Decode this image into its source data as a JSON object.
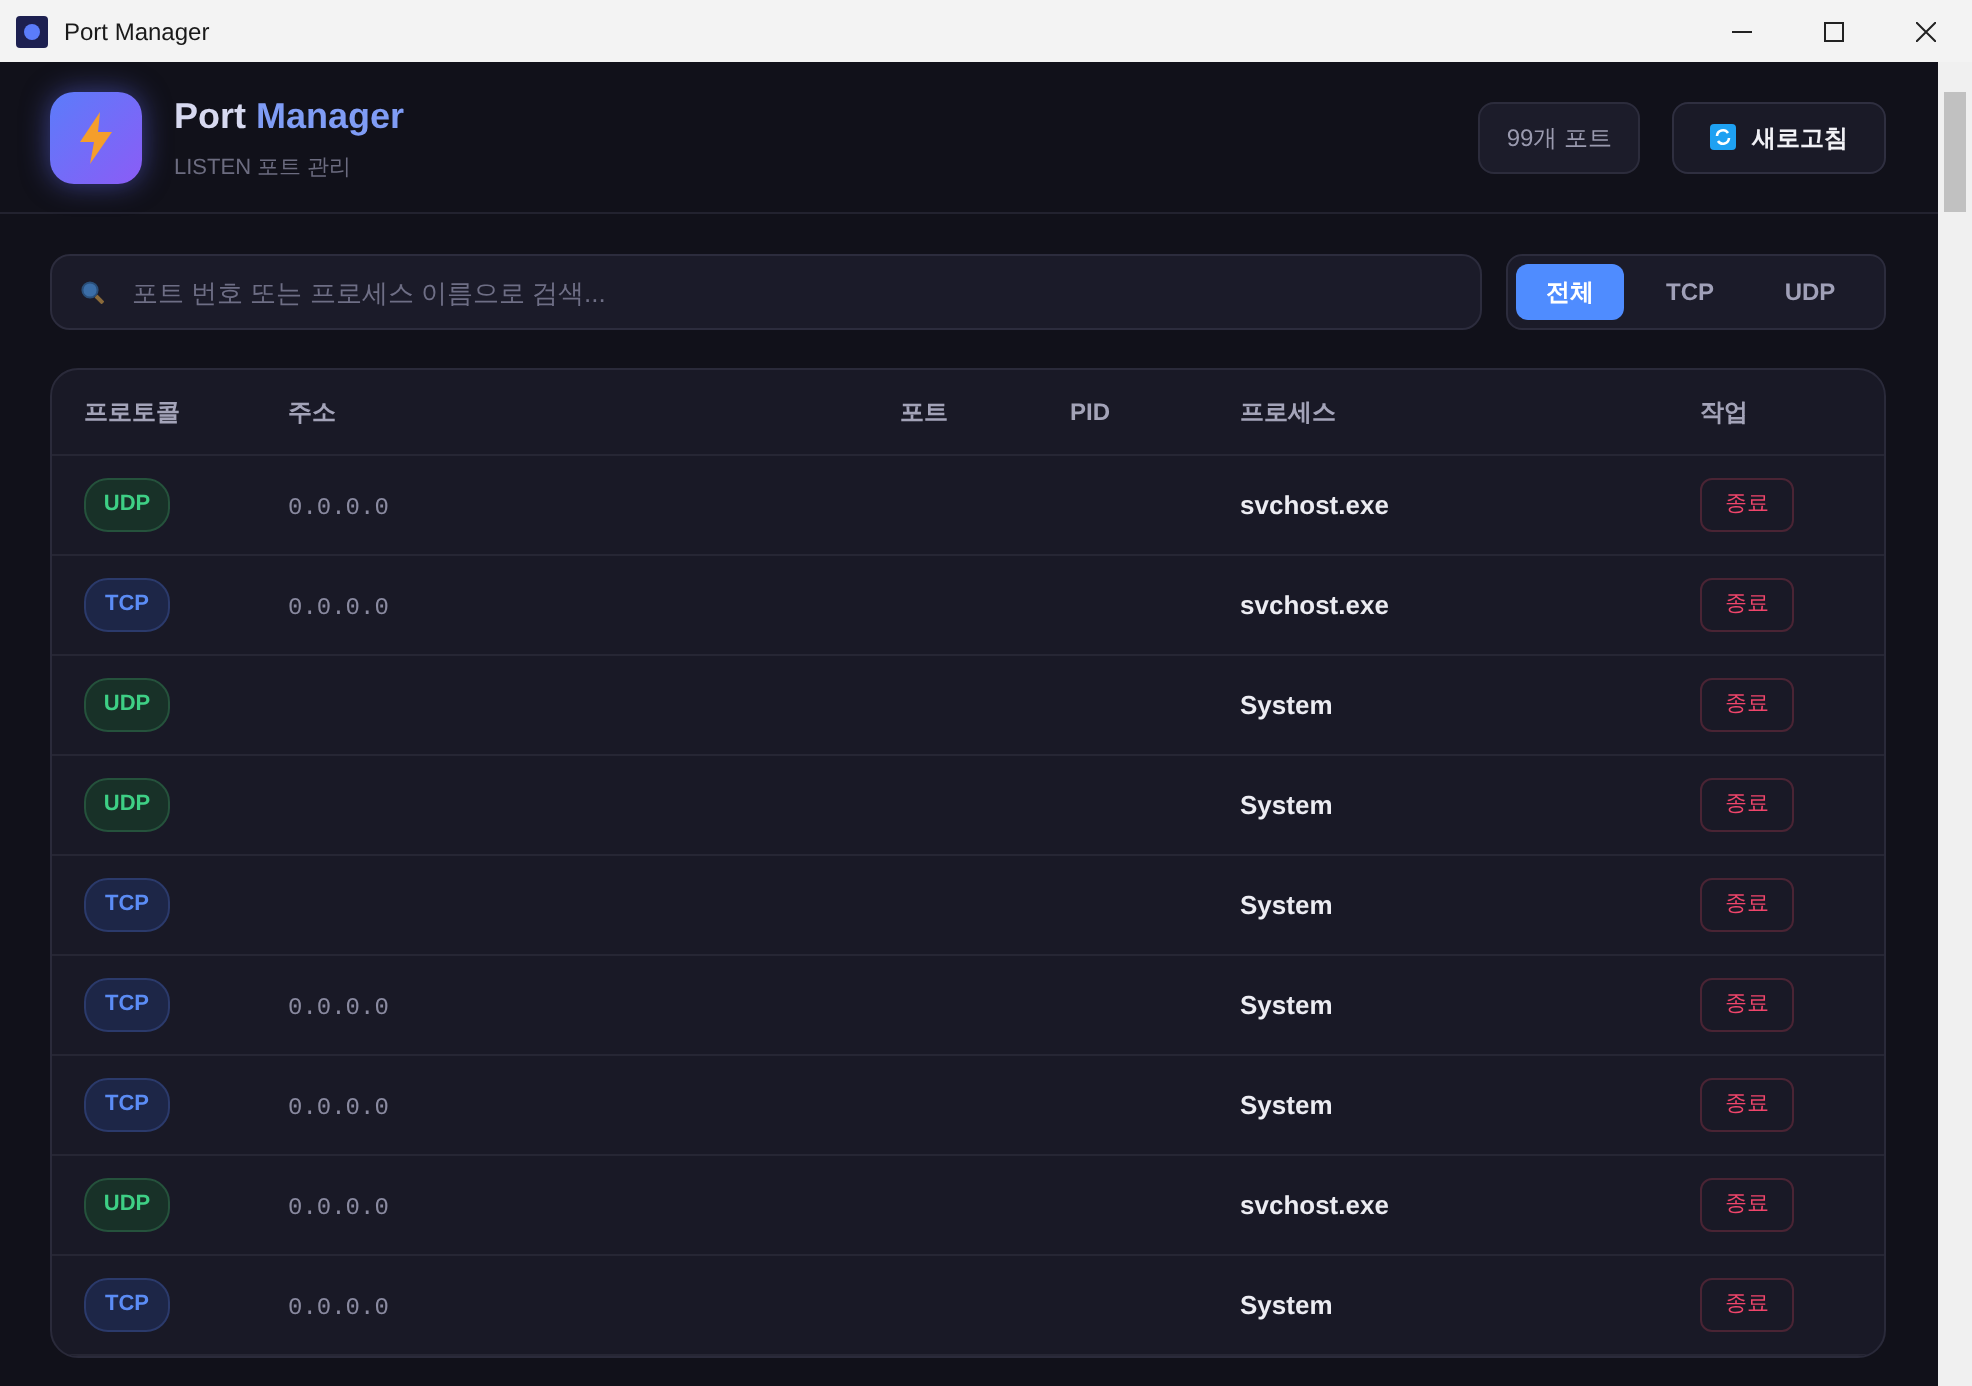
{
  "window": {
    "title": "Port Manager"
  },
  "header": {
    "title_part1": "Port",
    "title_part2": "Manager",
    "subtitle": "LISTEN 포트 관리",
    "port_count": "99개 포트",
    "refresh_label": "새로고침"
  },
  "search": {
    "placeholder": "포트 번호 또는 프로세스 이름으로 검색..."
  },
  "filters": [
    {
      "label": "전체",
      "selected": true
    },
    {
      "label": "TCP",
      "selected": false
    },
    {
      "label": "UDP",
      "selected": false
    }
  ],
  "table": {
    "columns": [
      "프로토콜",
      "주소",
      "포트",
      "PID",
      "프로세스",
      "작업"
    ],
    "rows": [
      {
        "protocol": "UDP",
        "address": "0.0.0.0",
        "process": "svchost.exe",
        "action": "종료"
      },
      {
        "protocol": "TCP",
        "address": "0.0.0.0",
        "process": "svchost.exe",
        "action": "종료"
      },
      {
        "protocol": "UDP",
        "process": "System",
        "action": "종료"
      },
      {
        "protocol": "UDP",
        "process": "System",
        "action": "종료"
      },
      {
        "protocol": "TCP",
        "process": "System",
        "action": "종료"
      },
      {
        "protocol": "TCP",
        "address": "0.0.0.0",
        "process": "System",
        "action": "종료"
      },
      {
        "protocol": "TCP",
        "address": "0.0.0.0",
        "process": "System",
        "action": "종료"
      },
      {
        "protocol": "UDP",
        "address": "0.0.0.0",
        "process": "svchost.exe",
        "action": "종료"
      },
      {
        "protocol": "TCP",
        "address": "0.0.0.0",
        "process": "System",
        "action": "종료"
      }
    ]
  }
}
